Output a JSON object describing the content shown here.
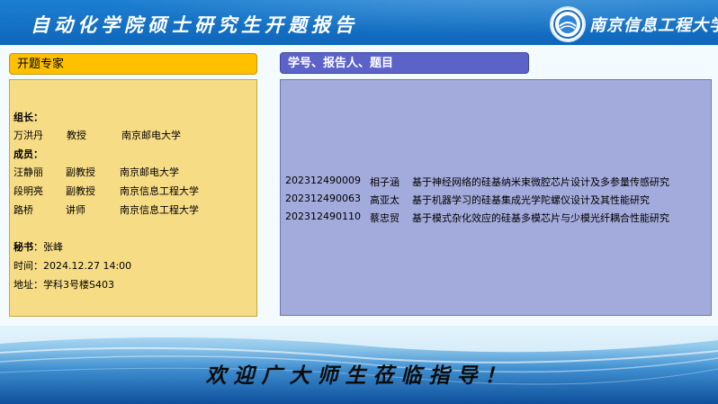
{
  "header": {
    "title": "自动化学院硕士研究生开题报告",
    "school_name": "南京信息工程大学"
  },
  "experts_panel": {
    "header": "开题专家",
    "leader_label": "组长",
    "leader": {
      "name": "万洪丹",
      "title": "教授",
      "affiliation": "南京邮电大学"
    },
    "members_label": "成员",
    "members": [
      {
        "name": "汪静丽",
        "title": "副教授",
        "affiliation": "南京邮电大学"
      },
      {
        "name": "段明亮",
        "title": "副教授",
        "affiliation": "南京信息工程大学"
      },
      {
        "name": "路桥",
        "title": "讲师",
        "affiliation": "南京信息工程大学"
      }
    ],
    "secretary_label": "秘书",
    "secretary": "张峰",
    "time_label": "时间",
    "time": "2024.12.27 14:00",
    "address_label": "地址",
    "address": "学科3号楼S403"
  },
  "reports_panel": {
    "header": "学号、报告人、题目",
    "rows": [
      {
        "id": "202312490009",
        "name": "相子涵",
        "topic": "基于神经网络的硅基纳米束微腔芯片设计及多参量传感研究"
      },
      {
        "id": "202312490063",
        "name": "高亚太",
        "topic": "基于机器学习的硅基集成光学陀螺仪设计及其性能研究"
      },
      {
        "id": "202312490110",
        "name": "蔡忠贸",
        "topic": "基于模式杂化效应的硅基多模芯片与少模光纤耦合性能研究"
      }
    ]
  },
  "footer": {
    "welcome": "欢迎广大师生莅临指导！"
  },
  "colors": {
    "top_bar": "#1270c4",
    "expert_header": "#ffc000",
    "expert_panel": "#f7dc86",
    "report_header": "#5b63c8",
    "report_panel": "#a3abdc"
  }
}
